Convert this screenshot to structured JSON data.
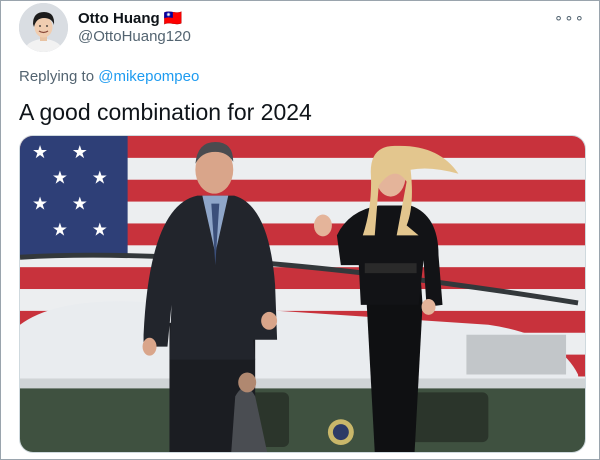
{
  "tweet": {
    "author": {
      "display_name": "Otto Huang 🇹🇼",
      "handle": "@OttoHuang120",
      "avatar_icon": "profile-photo"
    },
    "more_icon": "more-dots-icon",
    "more_glyph": "∘∘∘",
    "replying_to_prefix": "Replying to ",
    "replying_to_handle": "@mikepompeo",
    "text": "A good combination for 2024",
    "media": {
      "type": "photo",
      "alt": ""
    }
  },
  "colors": {
    "link": "#1d9bf0",
    "secondary_text": "#536471",
    "primary_text": "#0f1419"
  }
}
